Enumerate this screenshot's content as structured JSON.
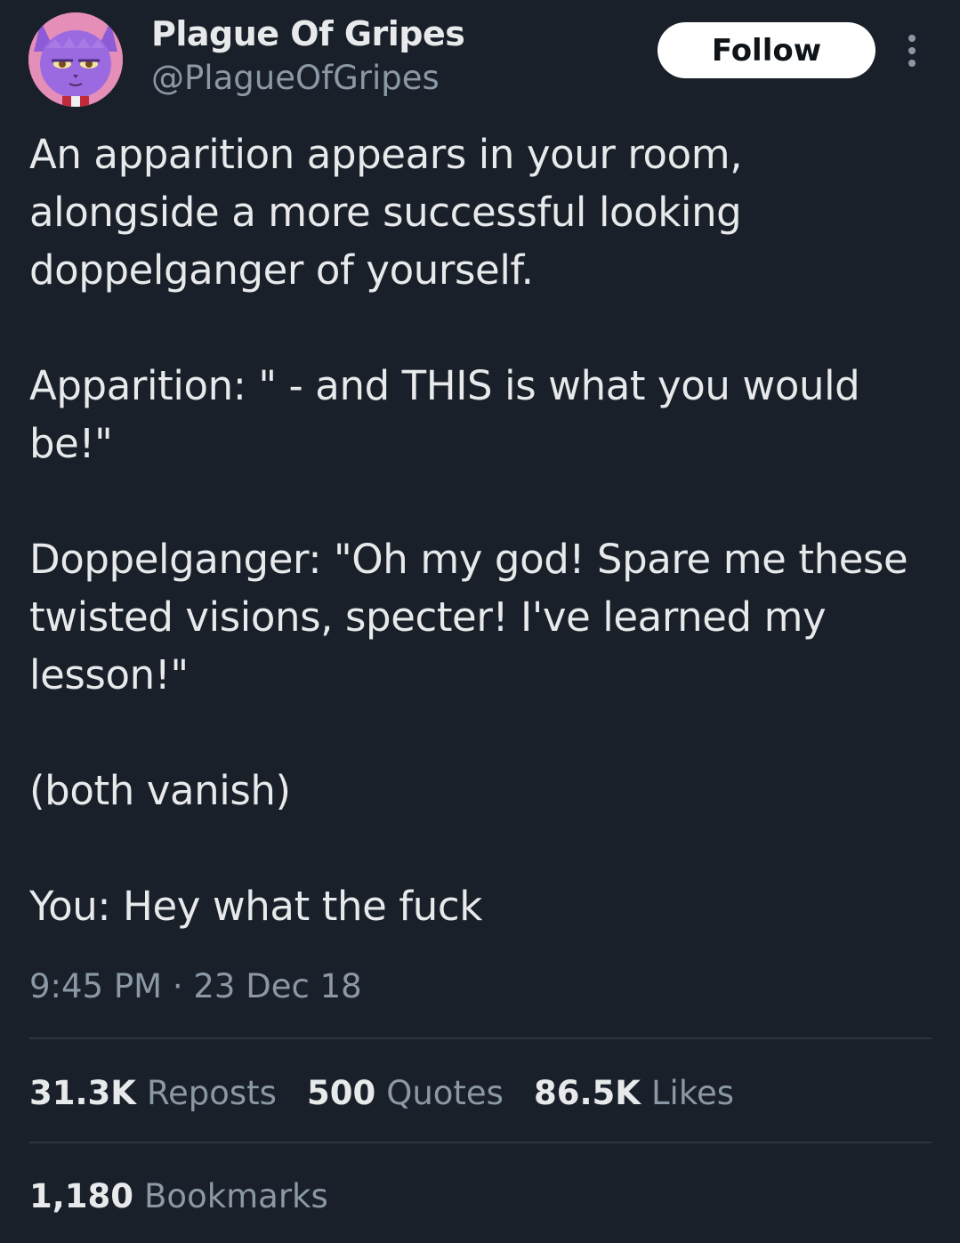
{
  "author": {
    "display_name": "Plague Of Gripes",
    "handle": "@PlagueOfGripes",
    "avatar_icon": "purple-cat-character-avatar"
  },
  "actions": {
    "follow_label": "Follow",
    "more_icon": "vertical-ellipsis-icon"
  },
  "tweet": {
    "paragraphs": [
      "An apparition appears in your room,\nalongside a more successful looking\ndoppelganger of yourself.",
      "Apparition: \" - and THIS is what you would\nbe!\"",
      "Doppelganger: \"Oh my god! Spare me these\ntwisted visions, specter! I've learned my\nlesson!\"",
      "(both vanish)",
      "You: Hey what the fuck"
    ],
    "timestamp": "9:45 PM · 23 Dec 18"
  },
  "stats": {
    "reposts": {
      "count": "31.3K",
      "label": "Reposts"
    },
    "quotes": {
      "count": "500",
      "label": "Quotes"
    },
    "likes": {
      "count": "86.5K",
      "label": "Likes"
    },
    "bookmarks": {
      "count": "1,180",
      "label": "Bookmarks"
    }
  },
  "colors": {
    "background": "#1a202a",
    "primary_text": "#e7e9ea",
    "secondary_text": "#8b98a5",
    "follow_button_bg": "#ffffff",
    "divider": "#2f3640"
  }
}
